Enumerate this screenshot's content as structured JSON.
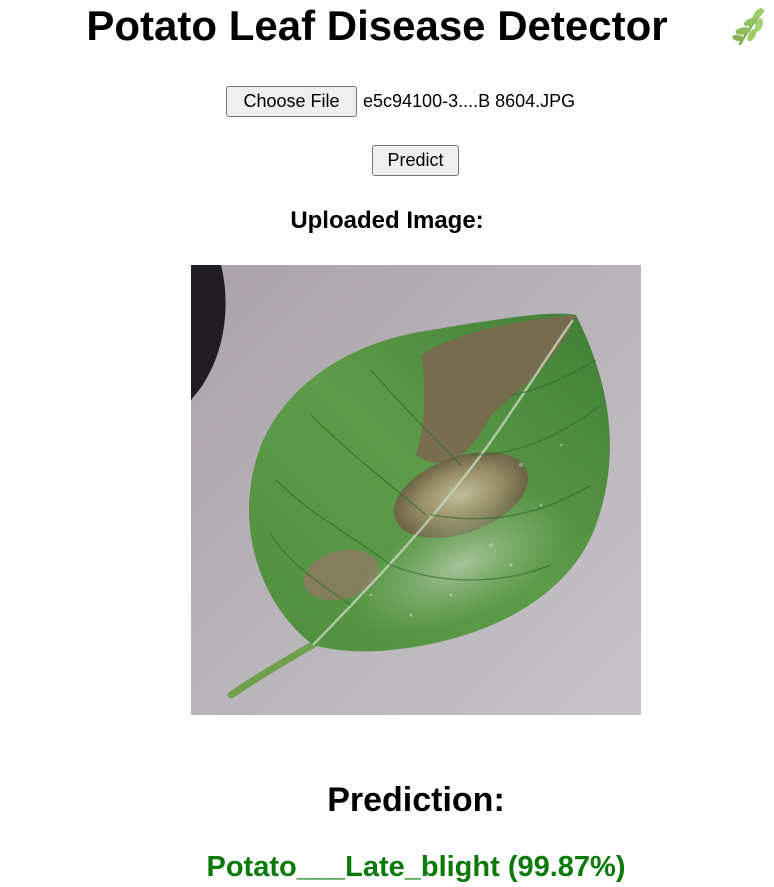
{
  "header": {
    "title": "Potato Leaf Disease Detector",
    "icon": "herb-icon"
  },
  "upload": {
    "choose_label": "Choose File",
    "file_name": "e5c94100-3....B 8604.JPG",
    "predict_label": "Predict"
  },
  "preview": {
    "label": "Uploaded Image:",
    "image_subject": "potato leaf with late blight lesion"
  },
  "result": {
    "heading": "Prediction:",
    "text": "Potato___Late_blight (99.87%)"
  },
  "colors": {
    "result_text": "#0a7a0a",
    "button_bg": "#efefef",
    "button_border": "#767676"
  }
}
